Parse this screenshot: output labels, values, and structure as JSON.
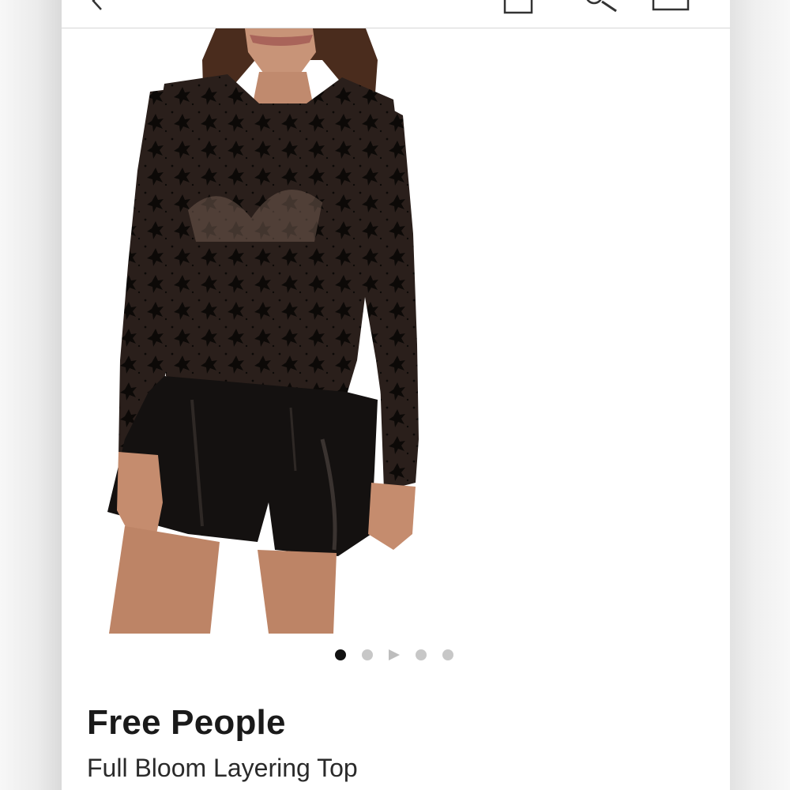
{
  "product": {
    "brand": "Free People",
    "title": "Full Bloom Layering Top"
  },
  "gallery": {
    "image_count": 5,
    "active_index": 0,
    "video_index": 2
  },
  "icons": {
    "back": "chevron-left-icon",
    "bag": "shopping-bag-icon",
    "search": "search-icon",
    "menu": "menu-icon"
  },
  "colors": {
    "text": "#1a1a1a",
    "dot_active": "#111111",
    "dot_inactive": "#c7c7c7",
    "divider": "#d6d6d6"
  }
}
